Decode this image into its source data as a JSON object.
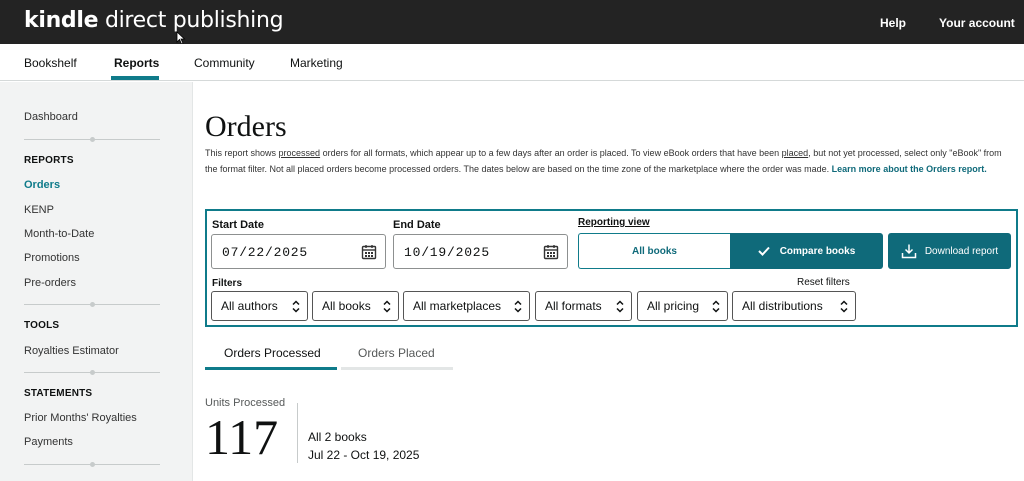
{
  "header": {
    "brand_prefix": "kindle",
    "brand_rest": " direct publishing",
    "help": "Help",
    "account": "Your account"
  },
  "tabs": [
    {
      "label": "Bookshelf"
    },
    {
      "label": "Reports"
    },
    {
      "label": "Community"
    },
    {
      "label": "Marketing"
    }
  ],
  "sidebar": {
    "dashboard": "Dashboard",
    "reports_heading": "REPORTS",
    "reports": [
      "Orders",
      "KENP",
      "Month-to-Date",
      "Promotions",
      "Pre-orders"
    ],
    "tools_heading": "TOOLS",
    "tools": [
      "Royalties Estimator"
    ],
    "statements_heading": "STATEMENTS",
    "statements": [
      "Prior Months' Royalties",
      "Payments"
    ]
  },
  "main": {
    "title": "Orders",
    "desc_1": "This report shows ",
    "desc_processed": "processed",
    "desc_2": " orders for all formats, which appear up to a few days after an order is placed. To view eBook orders that have been ",
    "desc_placed": "placed",
    "desc_3": ", but not yet processed, select only \"eBook\" from the format filter. Not all placed orders become processed orders. The dates below are based on the time zone of the marketplace where the order was made. ",
    "desc_learn_more": "Learn more about the Orders report."
  },
  "filters": {
    "start_label": "Start Date",
    "start_value": "07/22/2025",
    "end_label": "End Date",
    "end_value": "10/19/2025",
    "reporting_view_label": "Reporting view",
    "all_books_btn": "All books",
    "compare_books_btn": "Compare books",
    "download_btn": "Download report",
    "filters_label": "Filters",
    "reset_label": "Reset filters",
    "dropdowns": [
      "All authors",
      "All books",
      "All marketplaces",
      "All formats",
      "All pricing",
      "All distributions"
    ]
  },
  "order_tabs": [
    "Orders Processed",
    "Orders Placed"
  ],
  "summary": {
    "units_label": "Units Processed",
    "units_value": "117",
    "books": "All 2 books",
    "range": "Jul 22 - Oct 19, 2025"
  },
  "colors": {
    "accent": "#0f7b8a",
    "accent_dark": "#0f6a7a",
    "topbar": "#232323",
    "sidebar_bg": "#f2f3f3"
  }
}
